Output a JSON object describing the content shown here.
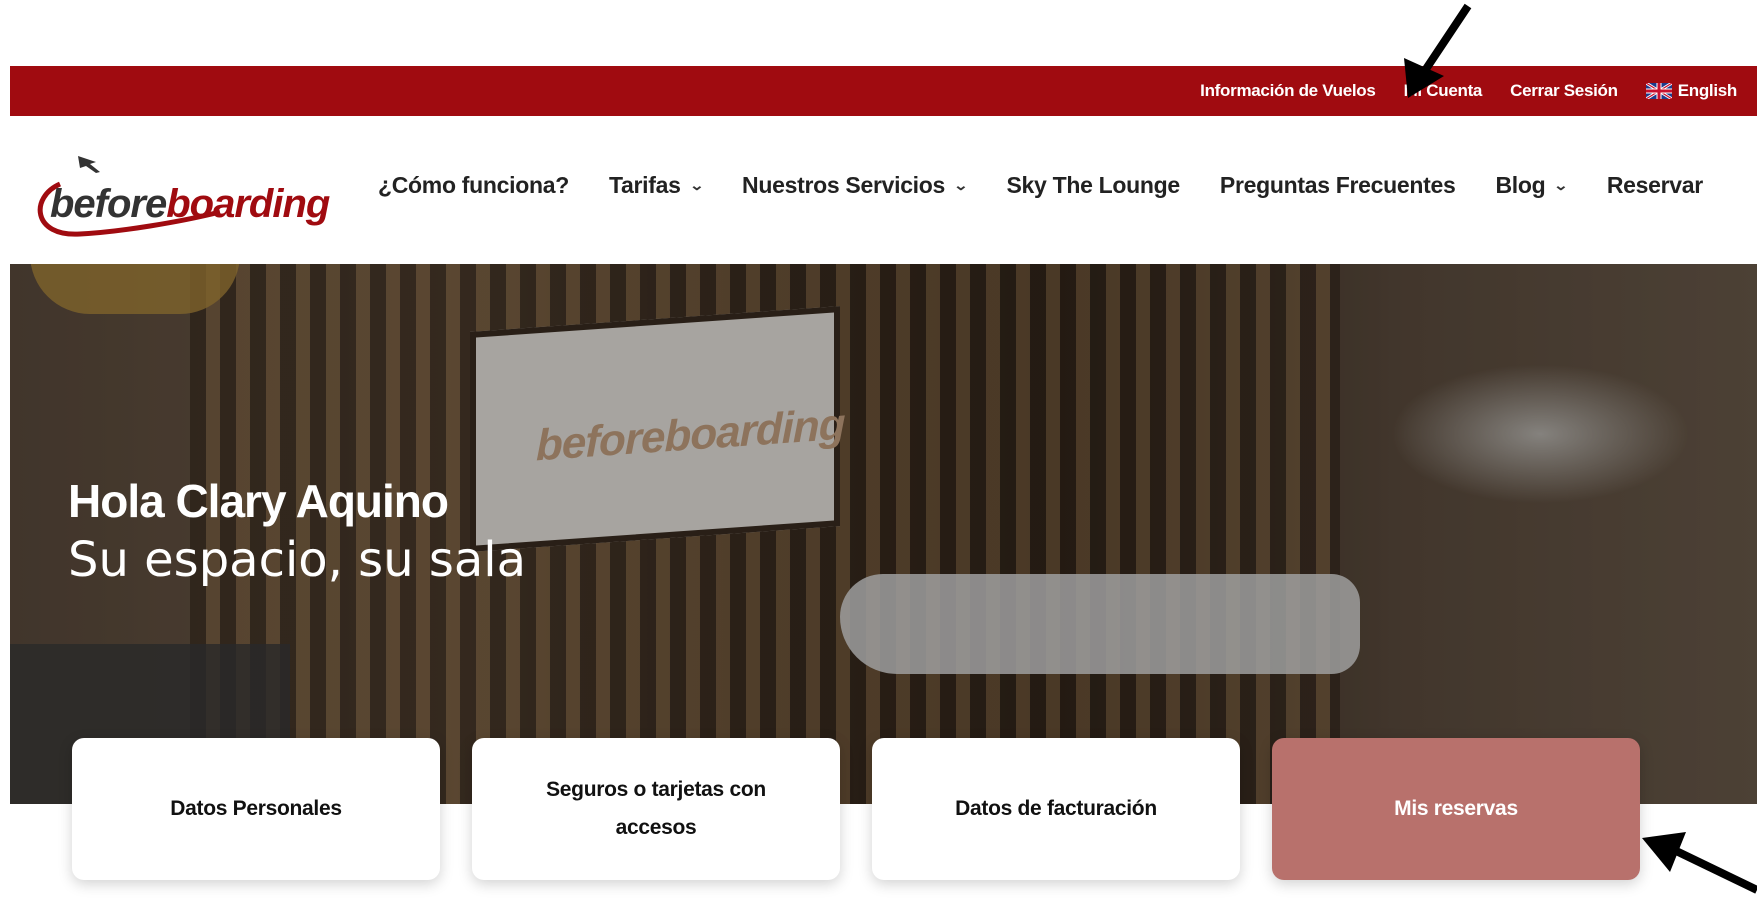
{
  "topbar": {
    "links": [
      {
        "label": "Información de Vuelos"
      },
      {
        "label": "Mi Cuenta"
      },
      {
        "label": "Cerrar Sesión"
      },
      {
        "label": "English",
        "icon": "uk-flag-icon"
      }
    ],
    "color": "#a00b10"
  },
  "logo": {
    "part1": "before",
    "part2": "boarding"
  },
  "nav": {
    "items": [
      {
        "label": "¿Cómo funciona?",
        "dropdown": false
      },
      {
        "label": "Tarifas",
        "dropdown": true
      },
      {
        "label": "Nuestros Servicios",
        "dropdown": true
      },
      {
        "label": "Sky The Lounge",
        "dropdown": false
      },
      {
        "label": "Preguntas Frecuentes",
        "dropdown": false
      },
      {
        "label": "Blog",
        "dropdown": true
      },
      {
        "label": "Reservar",
        "dropdown": false
      }
    ]
  },
  "hero": {
    "greeting": "Hola Clary Aquino",
    "subtitle": "Su espacio, su sala",
    "sign_part1": "before",
    "sign_part2": "boarding"
  },
  "cards": [
    {
      "label": "Datos Personales",
      "active": false
    },
    {
      "label": "Seguros o tarjetas con accesos",
      "active": false
    },
    {
      "label": "Datos de facturación",
      "active": false
    },
    {
      "label": "Mis reservas",
      "active": true
    }
  ],
  "colors": {
    "brand": "#a00b10",
    "active_card": "#b8716c"
  }
}
